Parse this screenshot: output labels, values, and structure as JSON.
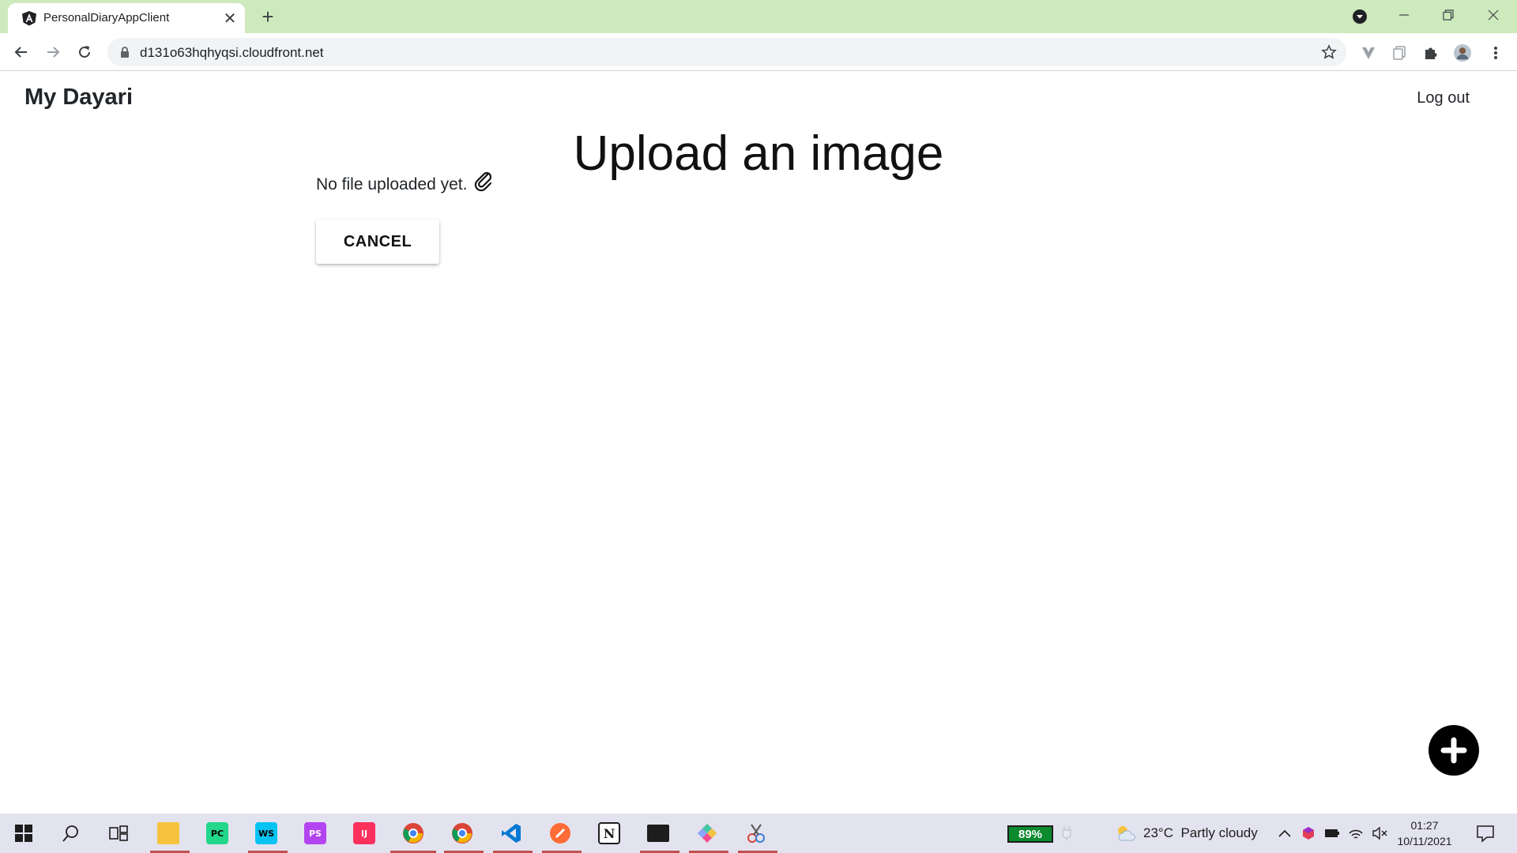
{
  "browser": {
    "tab_title": "PersonalDiaryAppClient",
    "url": "d131o63hqhyqsi.cloudfront.net"
  },
  "app": {
    "brand": "My Dayari",
    "logout_label": "Log out"
  },
  "page": {
    "title": "Upload an image",
    "no_file_text": "No file uploaded yet.",
    "cancel_label": "CANCEL"
  },
  "taskbar": {
    "apps": [
      "file-explorer",
      "pycharm",
      "webstorm",
      "phpstorm",
      "intellij",
      "chrome",
      "chrome-profile",
      "vscode",
      "postman",
      "notion",
      "terminal",
      "git-kraken",
      "snipping-tool"
    ],
    "battery_level": "89%",
    "weather_temp": "23°C",
    "weather_desc": "Partly cloudy",
    "time": "01:27",
    "date": "10/11/2021"
  },
  "colors": {
    "tabbar": "#cdeabd",
    "battery": "#0c8a2e",
    "fab": "#000000"
  }
}
